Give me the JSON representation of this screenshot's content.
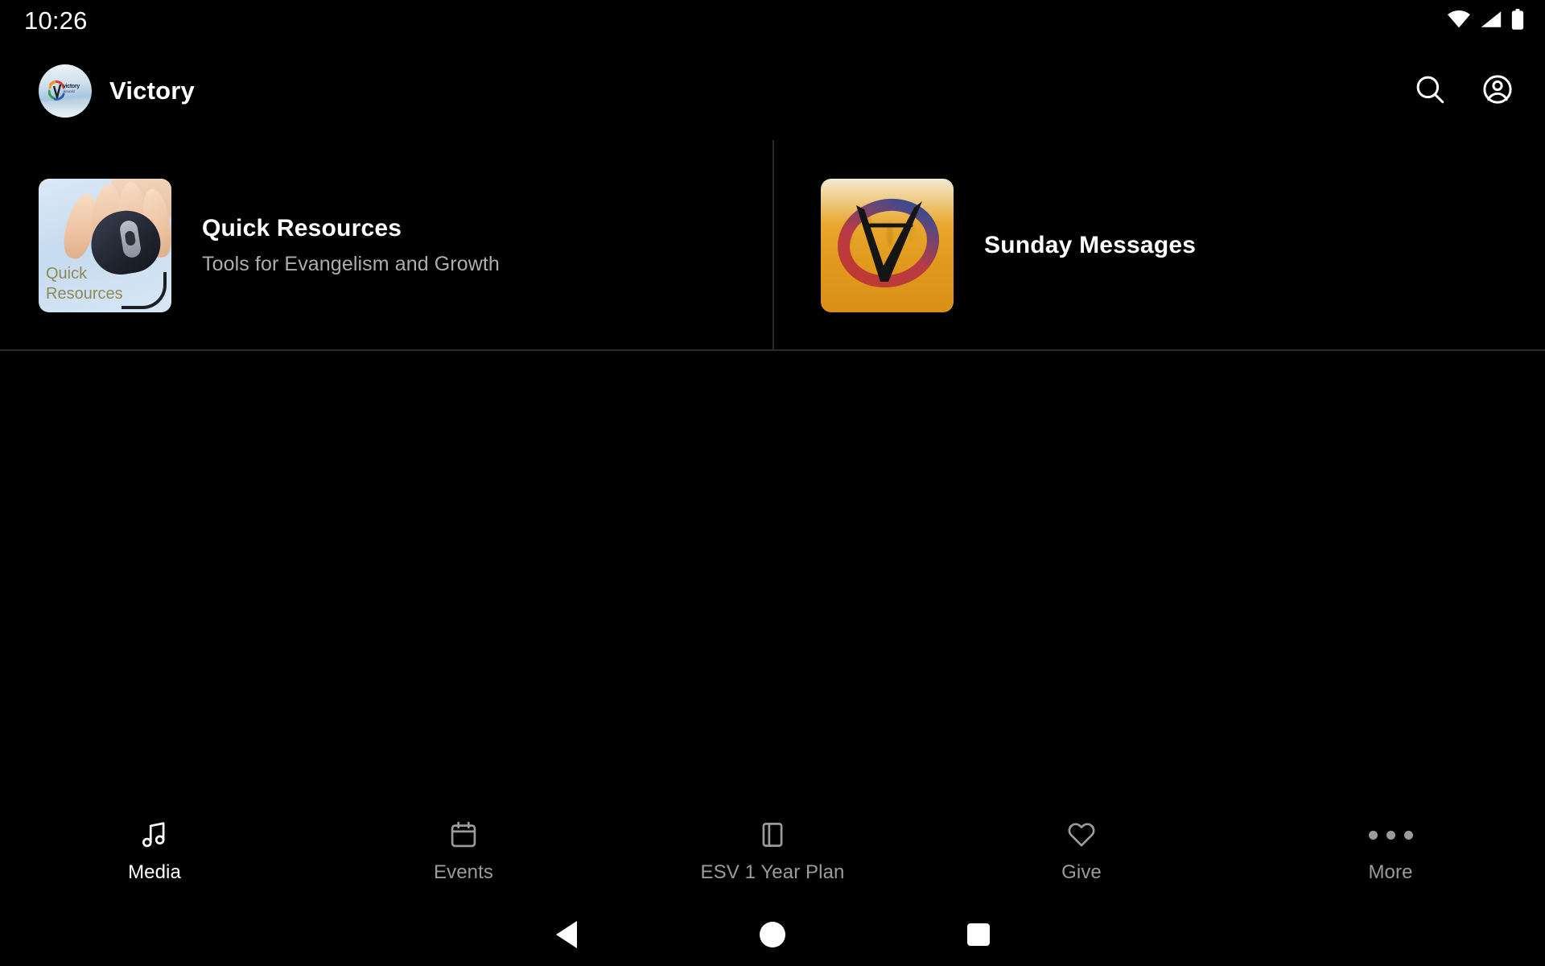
{
  "status_bar": {
    "clock": "10:26",
    "icons": [
      "wifi-icon",
      "cellular-signal-icon",
      "battery-icon"
    ]
  },
  "app_bar": {
    "logo": {
      "name": "victory-logo",
      "brand_line1": "victory",
      "brand_line2": "oleworld"
    },
    "title": "Victory",
    "actions": [
      {
        "name": "search-icon",
        "label": "Search"
      },
      {
        "name": "account-circle-icon",
        "label": "Account"
      }
    ]
  },
  "main": {
    "tiles": [
      {
        "title": "Quick Resources",
        "subtitle": "Tools for Evangelism and Growth",
        "thumbnail_name": "quick-resources-thumbnail",
        "thumbnail_caption_line1": "Quick",
        "thumbnail_caption_line2": "Resources"
      },
      {
        "title": "Sunday Messages",
        "subtitle": "",
        "thumbnail_name": "sunday-messages-thumbnail"
      }
    ]
  },
  "bottom_nav": {
    "items": [
      {
        "label": "Media",
        "icon": "music-note-icon",
        "active": true
      },
      {
        "label": "Events",
        "icon": "calendar-icon",
        "active": false
      },
      {
        "label": "ESV 1 Year Plan",
        "icon": "book-icon",
        "active": false
      },
      {
        "label": "Give",
        "icon": "heart-icon",
        "active": false
      },
      {
        "label": "More",
        "icon": "more-horizontal-icon",
        "active": false
      }
    ]
  },
  "system_nav": {
    "back": "back-button",
    "home": "home-button",
    "recents": "recents-button"
  },
  "colors": {
    "background": "#000000",
    "primary_text": "#ffffff",
    "secondary_text": "#adadad",
    "inactive_nav": "#9b9b9b",
    "divider": "#2b2b2b"
  }
}
